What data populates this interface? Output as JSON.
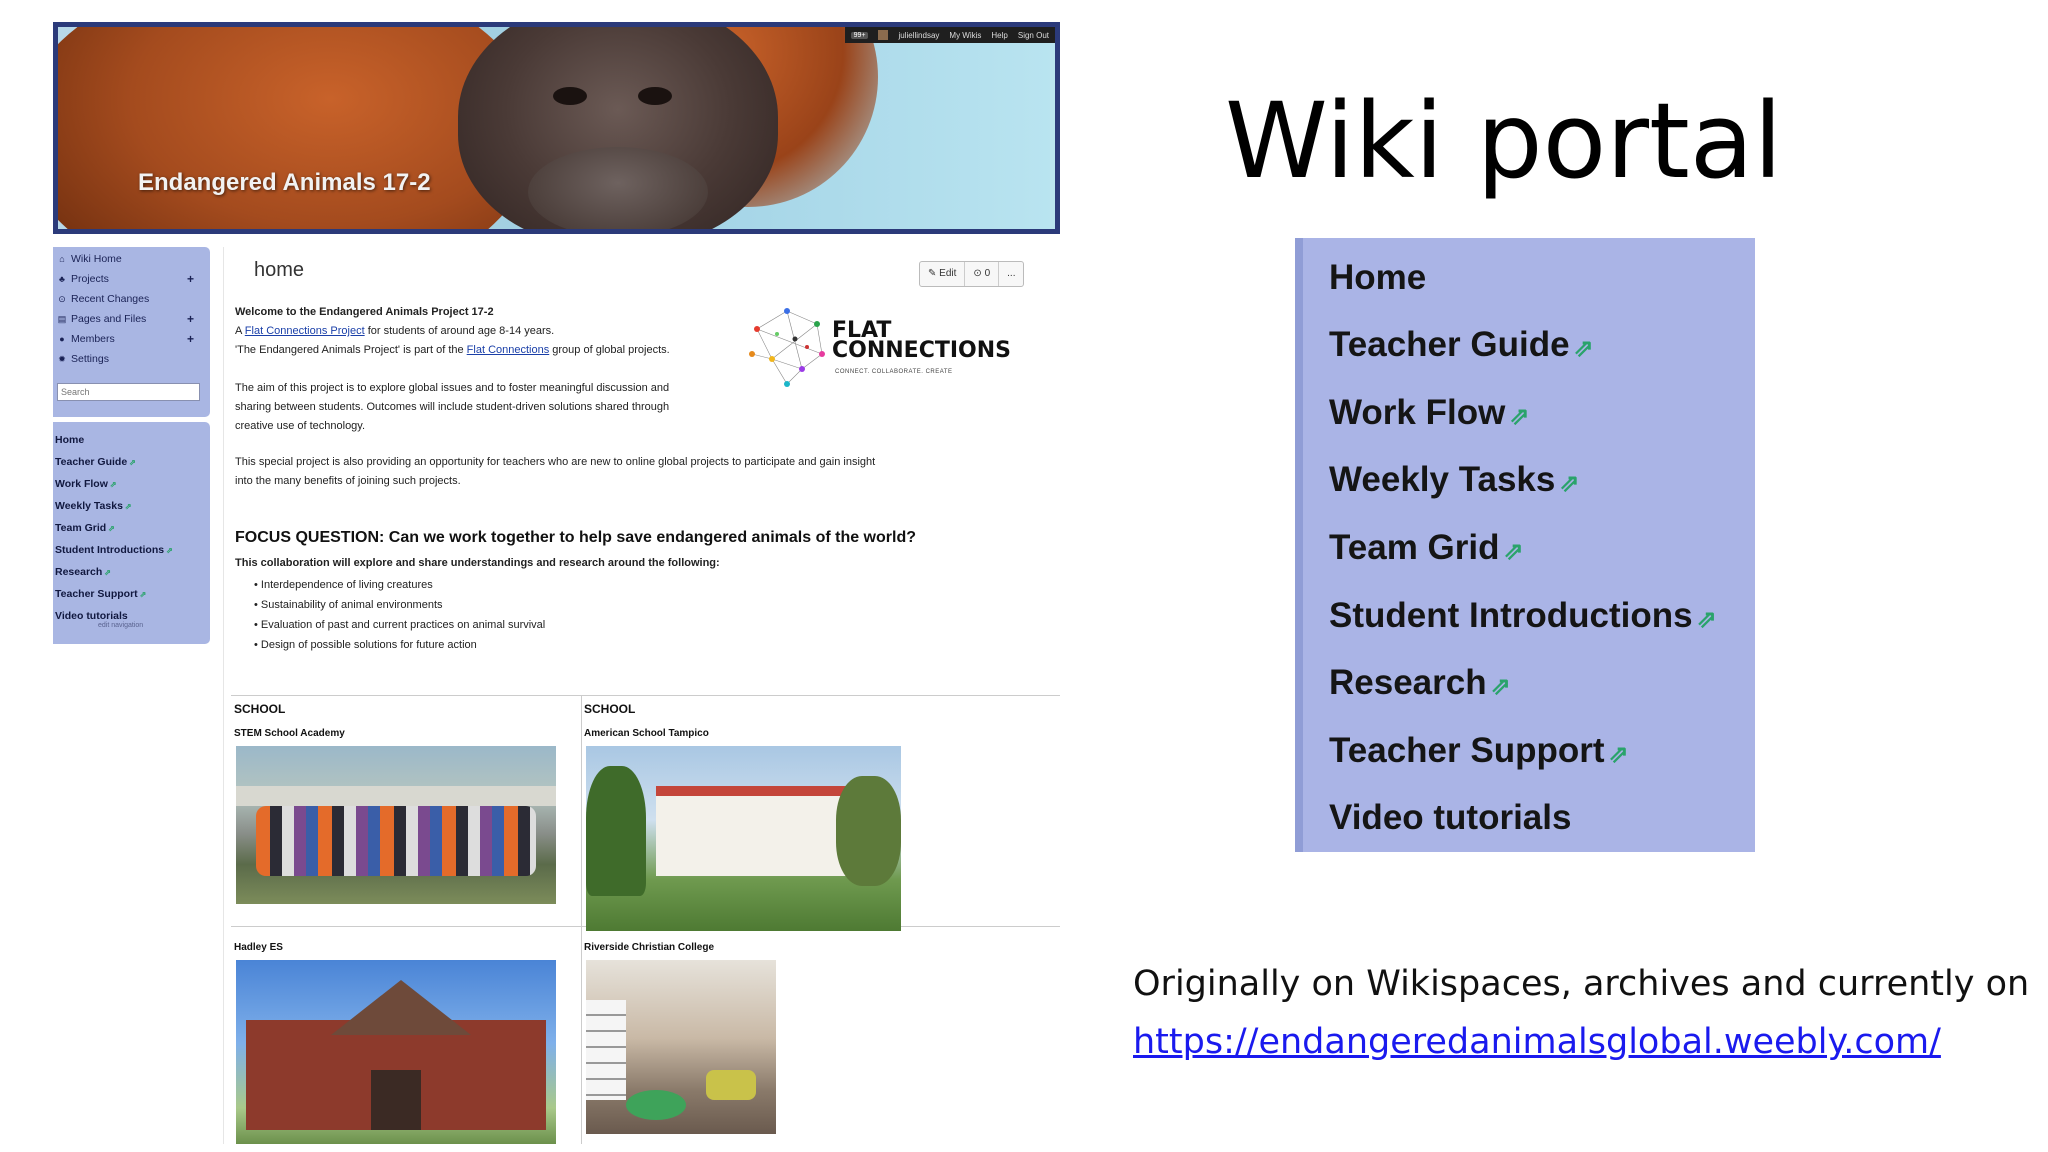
{
  "slide": {
    "title": "Wiki portal",
    "caption_line1": "Originally on Wikispaces, archives and currently on",
    "caption_link": "https://endangeredanimalsglobal.weebly.com/"
  },
  "portal": {
    "items": [
      {
        "label": "Home",
        "external": false
      },
      {
        "label": "Teacher Guide",
        "external": true
      },
      {
        "label": "Work Flow",
        "external": true
      },
      {
        "label": "Weekly Tasks",
        "external": true
      },
      {
        "label": "Team Grid",
        "external": true
      },
      {
        "label": "Student Introductions",
        "external": true
      },
      {
        "label": "Research",
        "external": true
      },
      {
        "label": "Teacher Support",
        "external": true
      },
      {
        "label": "Video tutorials",
        "external": false
      }
    ],
    "external_icon": "external-link-icon"
  },
  "wiki": {
    "banner_title": "Endangered Animals 17-2",
    "userbar": {
      "badge": "99+",
      "user": "juliellindsay",
      "my_wikis": "My Wikis",
      "help": "Help",
      "sign_out": "Sign Out"
    },
    "nav": [
      {
        "label": "Wiki Home",
        "icon": "home-icon",
        "plus": false
      },
      {
        "label": "Projects",
        "icon": "projects-icon",
        "plus": true
      },
      {
        "label": "Recent Changes",
        "icon": "clock-icon",
        "plus": false
      },
      {
        "label": "Pages and Files",
        "icon": "file-icon",
        "plus": true
      },
      {
        "label": "Members",
        "icon": "members-icon",
        "plus": true
      },
      {
        "label": "Settings",
        "icon": "gear-icon",
        "plus": false
      }
    ],
    "search_placeholder": "Search",
    "side_links": [
      {
        "label": "Home",
        "external": false
      },
      {
        "label": "Teacher Guide",
        "external": true
      },
      {
        "label": "Work Flow",
        "external": true
      },
      {
        "label": "Weekly Tasks",
        "external": true
      },
      {
        "label": "Team Grid",
        "external": true
      },
      {
        "label": "Student Introductions",
        "external": true
      },
      {
        "label": "Research",
        "external": true
      },
      {
        "label": "Teacher Support",
        "external": true
      },
      {
        "label": "Video tutorials",
        "external": false
      }
    ],
    "edit_navigation": "edit navigation",
    "page_name": "home",
    "buttons": {
      "edit": "Edit",
      "comments": "0",
      "more": "..."
    },
    "welcome": "Welcome to the Endangered Animals Project 17-2",
    "intro": {
      "a": "A ",
      "link1": "Flat Connections Project",
      "b": " for students of around age 8-14 years.",
      "c": "'The Endangered Animals Project' is part of the ",
      "link2": "Flat Connections",
      "d": " group of global projects."
    },
    "aim": [
      "The aim of this project is to explore global issues and to foster meaningful discussion and",
      "sharing between students. Outcomes will include student-driven solutions shared through",
      "creative use of technology."
    ],
    "special": [
      "This special project is also providing an opportunity for teachers who are new to online global projects to participate and gain insight",
      "into the many benefits of joining such projects."
    ],
    "focus_question": "FOCUS QUESTION: Can we work together to help save endangered animals of the world?",
    "collab": "This collaboration will explore and share understandings and research around the following:",
    "bullets": [
      "Interdependence of living creatures",
      "Sustainability of animal environments",
      "Evaluation of past and current practices on animal survival",
      "Design of possible solutions for future action"
    ],
    "logo": {
      "line1": "FLAT",
      "line2": "CONNECTIONS",
      "tagline": "CONNECT. COLLABORATE. CREATE"
    },
    "school_header": "SCHOOL",
    "schools": [
      "STEM School Academy",
      "American School Tampico",
      "Hadley ES",
      "Riverside Christian College"
    ]
  }
}
